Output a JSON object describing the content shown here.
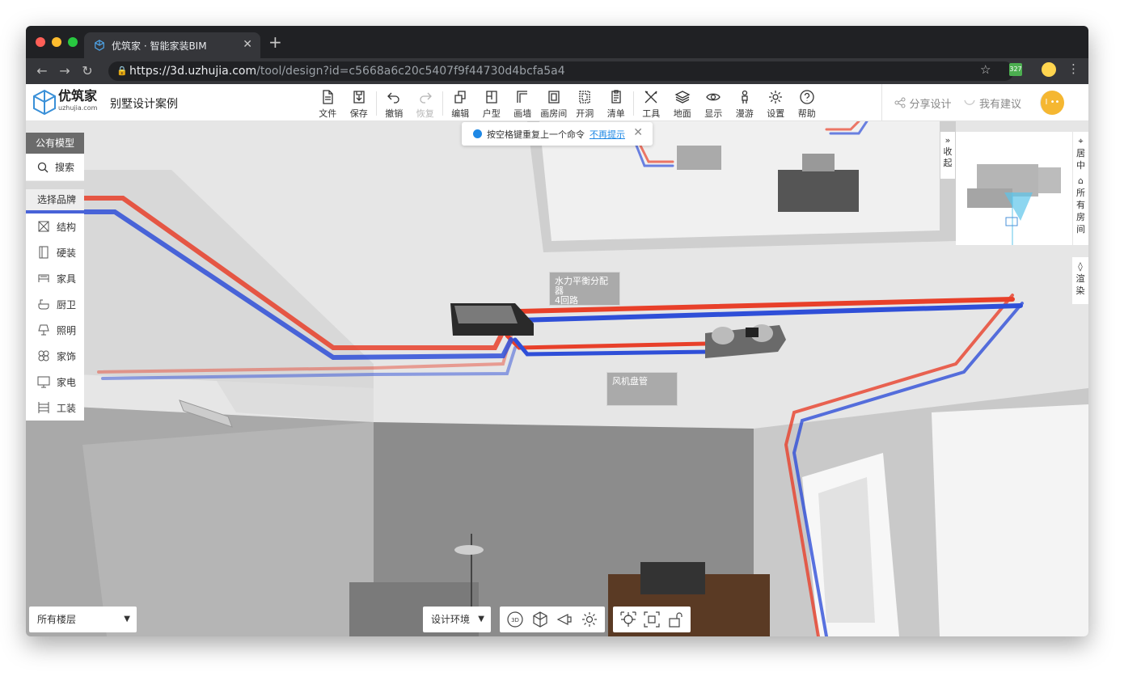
{
  "browser": {
    "tab_title": "优筑家 · 智能家装BIM",
    "new_tab": "+",
    "url_host": "https://3d.uzhujia.com",
    "url_path": "/tool/design?id=c5668a6c20c5407f9f44730d4bcfa5a4",
    "ext_label": "327"
  },
  "header": {
    "brand_name": "优筑家",
    "brand_domain": "uzhujia.com",
    "project_title": "别墅设计案例",
    "tools": [
      {
        "label": "文件",
        "icon": "file-icon"
      },
      {
        "label": "保存",
        "icon": "save-icon"
      },
      {
        "label": "撤销",
        "icon": "undo-icon"
      },
      {
        "label": "恢复",
        "icon": "redo-icon",
        "disabled": true
      },
      {
        "label": "编辑",
        "icon": "edit-icon"
      },
      {
        "label": "户型",
        "icon": "floorplan-icon"
      },
      {
        "label": "画墙",
        "icon": "draw-wall-icon"
      },
      {
        "label": "画房间",
        "icon": "draw-room-icon"
      },
      {
        "label": "开洞",
        "icon": "opening-icon"
      },
      {
        "label": "清单",
        "icon": "list-icon"
      },
      {
        "label": "工具",
        "icon": "tools-icon"
      },
      {
        "label": "地面",
        "icon": "floor-layers-icon"
      },
      {
        "label": "显示",
        "icon": "eye-icon"
      },
      {
        "label": "漫游",
        "icon": "walk-icon"
      },
      {
        "label": "设置",
        "icon": "gear-icon"
      },
      {
        "label": "帮助",
        "icon": "help-icon"
      }
    ],
    "share_label": "分享设计",
    "suggest_label": "我有建议",
    "user_avatar_text": "I ••"
  },
  "left_panel": {
    "public_model": "公有模型",
    "search": "搜索",
    "select_brand": "选择品牌",
    "categories": [
      {
        "label": "结构",
        "icon": "structure-icon"
      },
      {
        "label": "硬装",
        "icon": "door-icon"
      },
      {
        "label": "家具",
        "icon": "bed-icon"
      },
      {
        "label": "厨卫",
        "icon": "bathtub-icon"
      },
      {
        "label": "照明",
        "icon": "lamp-icon"
      },
      {
        "label": "家饰",
        "icon": "decor-icon"
      },
      {
        "label": "家电",
        "icon": "monitor-icon"
      },
      {
        "label": "工装",
        "icon": "shelf-icon"
      }
    ]
  },
  "toast": {
    "message": "按空格键重复上一个命令",
    "link": "不再提示"
  },
  "minimap": {
    "collapse": "收起",
    "center": "居中",
    "all_rooms": "所有房间",
    "render": "渲染"
  },
  "scene_labels": {
    "distributor": "水力平衡分配器\n4回路",
    "fan_coil": "风机盘管"
  },
  "bottom": {
    "floor_select": "所有楼层",
    "env_select": "设计环境",
    "view_3d": "3D"
  },
  "colors": {
    "hot_pipe": "#e8402a",
    "cold_pipe": "#2f4fd8",
    "accent": "#1e88e5",
    "avatar": "#f5b731"
  }
}
